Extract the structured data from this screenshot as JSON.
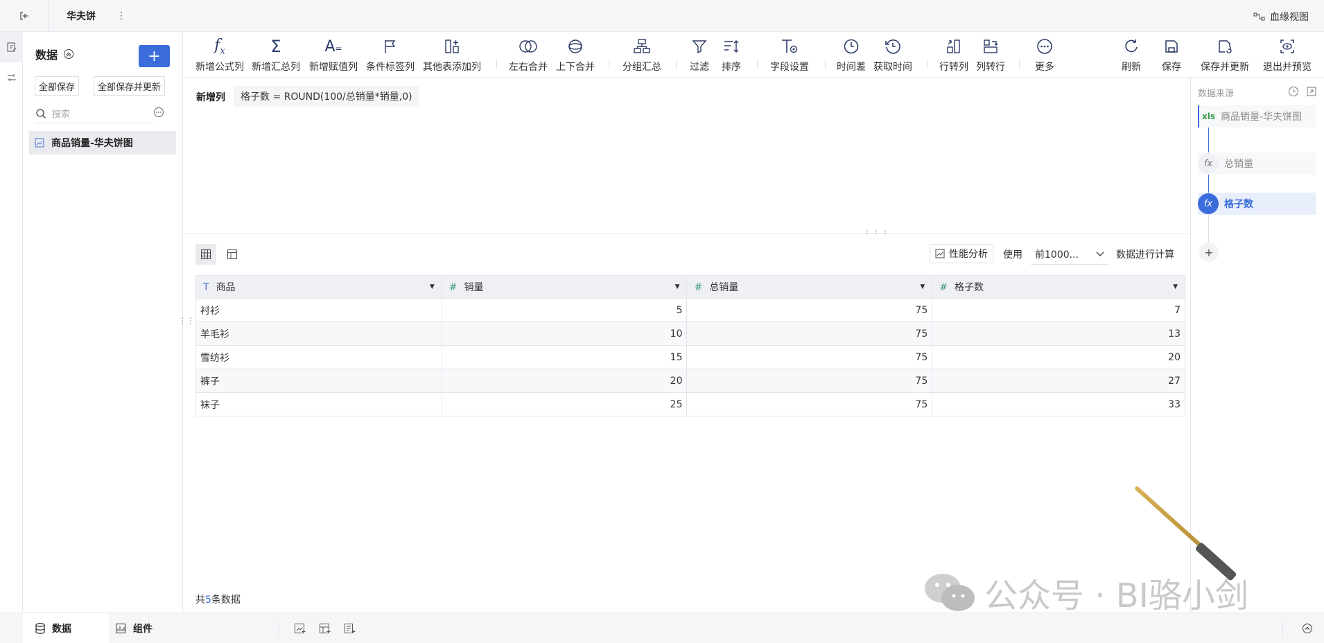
{
  "header": {
    "title": "华夫饼",
    "lineage_label": "血缘视图"
  },
  "data_panel": {
    "title": "数据",
    "add_label": "+",
    "save_all": "全部保存",
    "save_all_update": "全部保存并更新",
    "search_placeholder": "搜索",
    "items": [
      {
        "label": "商品销量-华夫饼图"
      }
    ]
  },
  "toolbar": {
    "items": [
      {
        "label": "新增公式列",
        "icon": "fx-icon"
      },
      {
        "label": "新增汇总列",
        "icon": "sigma-icon"
      },
      {
        "label": "新增赋值列",
        "icon": "assign-icon"
      },
      {
        "label": "条件标签列",
        "icon": "flag-icon"
      },
      {
        "label": "其他表添加列",
        "icon": "add-column-icon"
      },
      {
        "label": "左右合并",
        "icon": "merge-lr-icon"
      },
      {
        "label": "上下合并",
        "icon": "merge-ud-icon"
      },
      {
        "label": "分组汇总",
        "icon": "group-icon"
      },
      {
        "label": "过滤",
        "icon": "filter-icon"
      },
      {
        "label": "排序",
        "icon": "sort-icon"
      },
      {
        "label": "字段设置",
        "icon": "field-settings-icon"
      },
      {
        "label": "时间差",
        "icon": "clock-icon"
      },
      {
        "label": "获取时间",
        "icon": "clock-back-icon"
      },
      {
        "label": "行转列",
        "icon": "row-to-col-icon"
      },
      {
        "label": "列转行",
        "icon": "col-to-row-icon"
      },
      {
        "label": "更多",
        "icon": "more-icon"
      },
      {
        "label": "刷新",
        "icon": "refresh-icon"
      },
      {
        "label": "保存",
        "icon": "save-icon"
      },
      {
        "label": "保存并更新",
        "icon": "save-update-icon"
      },
      {
        "label": "退出并预览",
        "icon": "preview-icon"
      }
    ]
  },
  "formula": {
    "label": "新增列",
    "expression": "格子数 = ROUND(100/总销量*销量,0)"
  },
  "source_panel": {
    "title": "数据来源",
    "nodes": [
      {
        "label": "商品销量-华夫饼图",
        "badge": "xls"
      },
      {
        "label": "总销量",
        "badge": "fx"
      },
      {
        "label": "格子数",
        "badge": "fx"
      }
    ],
    "add_label": "+"
  },
  "grid": {
    "perf_label": "性能分析",
    "use_label": "使用",
    "select_value": "前1000...",
    "calc_label": "数据进行计算",
    "columns": [
      {
        "label": "商品",
        "type": "text"
      },
      {
        "label": "销量",
        "type": "number"
      },
      {
        "label": "总销量",
        "type": "number"
      },
      {
        "label": "格子数",
        "type": "number"
      }
    ],
    "rows": [
      [
        "衬衫",
        "5",
        "75",
        "7"
      ],
      [
        "羊毛衫",
        "10",
        "75",
        "13"
      ],
      [
        "雪纺衫",
        "15",
        "75",
        "20"
      ],
      [
        "裤子",
        "20",
        "75",
        "27"
      ],
      [
        "袜子",
        "25",
        "75",
        "33"
      ]
    ],
    "footer_prefix": "共",
    "footer_count": "5",
    "footer_suffix": "条数据"
  },
  "watermark": {
    "text": "公众号 · BI骆小剑"
  },
  "bottom": {
    "tab_data": "数据",
    "tab_component": "组件"
  }
}
